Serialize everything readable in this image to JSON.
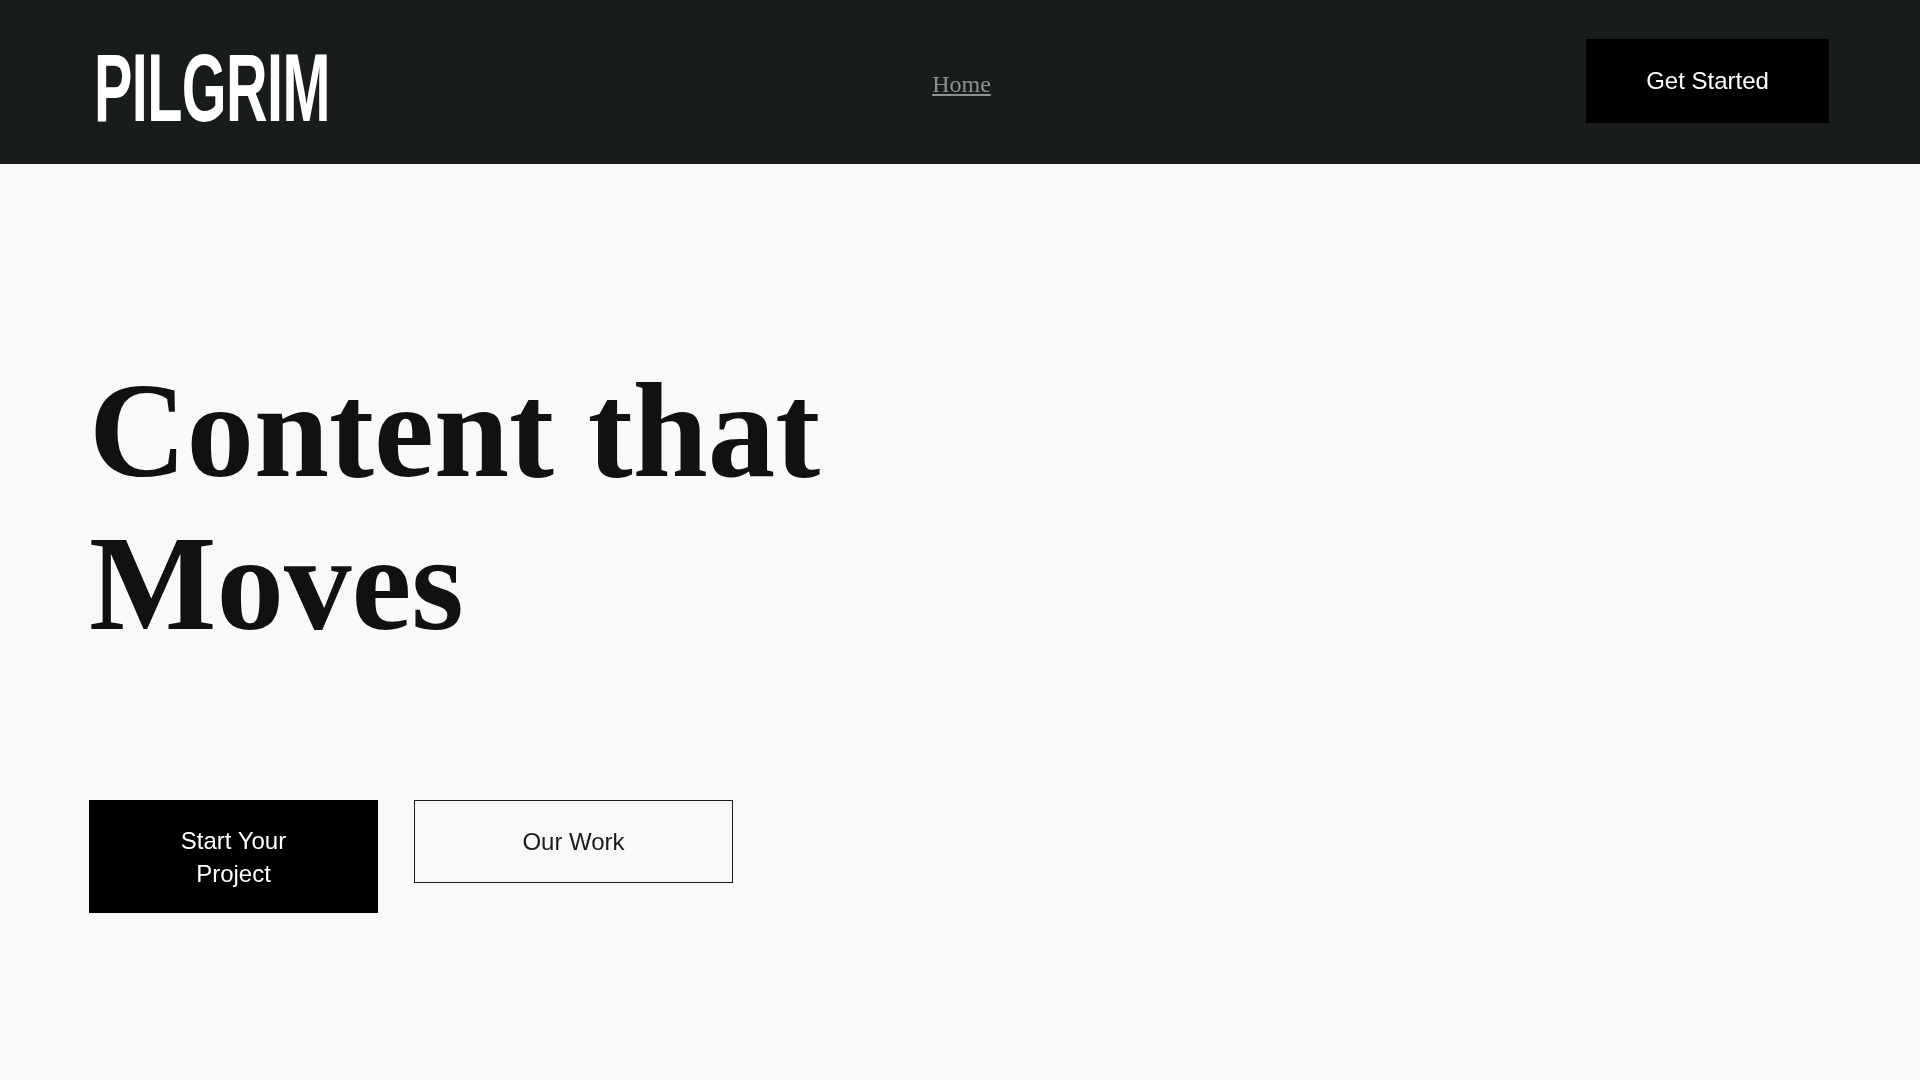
{
  "header": {
    "logo": "PILGRIM",
    "nav": [
      {
        "label": "Home"
      }
    ],
    "cta": "Get Started"
  },
  "hero": {
    "title": "Content that Moves",
    "buttons": [
      {
        "label": "Start Your Project",
        "kind": "primary"
      },
      {
        "label": "Our Work",
        "kind": "outline"
      }
    ]
  }
}
